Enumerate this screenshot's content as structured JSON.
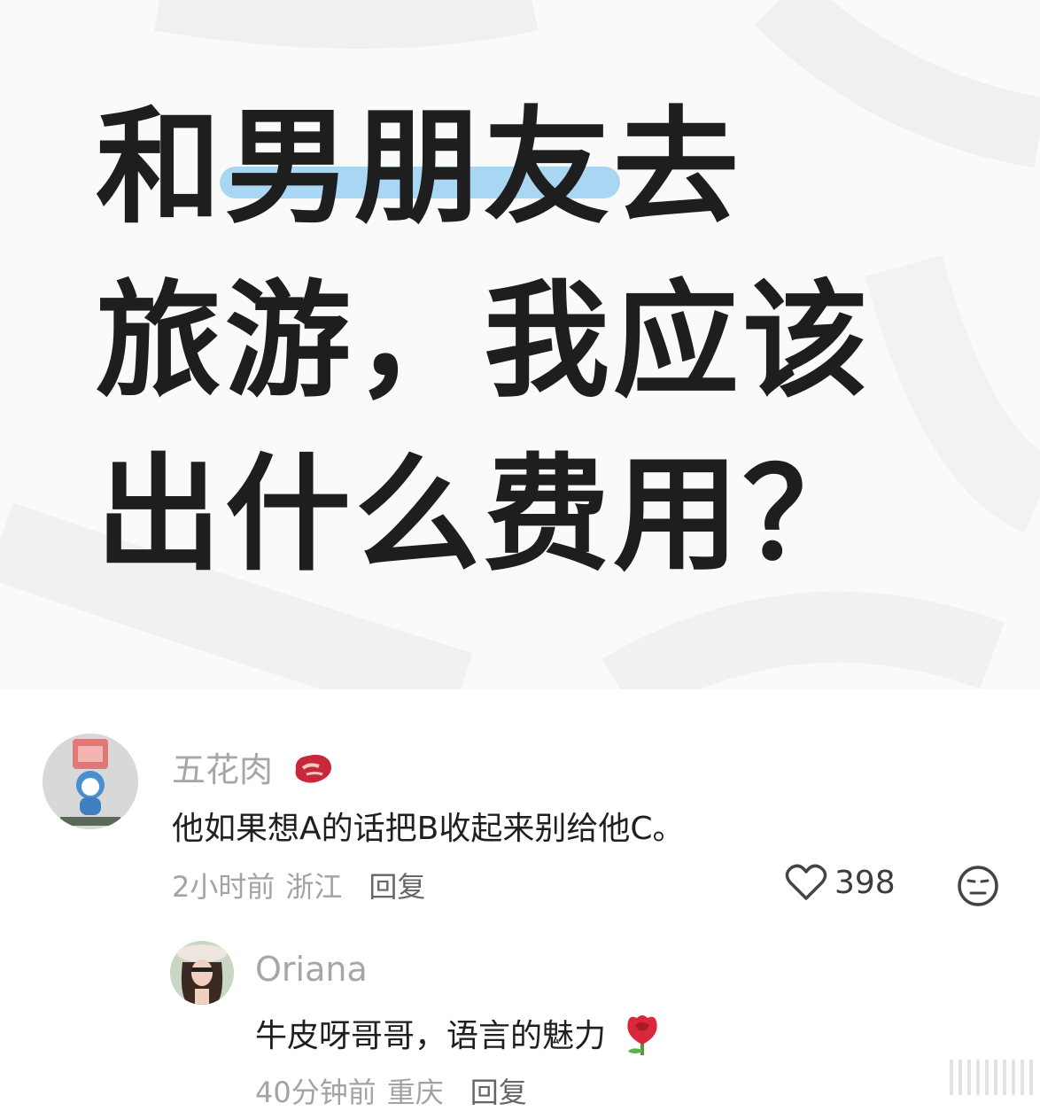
{
  "post": {
    "title_line1_pre": "和",
    "title_line1_highlight": "男朋友",
    "title_line1_post": "去",
    "title_line2": "旅游，我应该",
    "title_line3": "出什么费用？",
    "highlight_color": "#a9d7f3"
  },
  "comments": [
    {
      "name": "五花肉",
      "badge_icon": "steak-icon",
      "text": "他如果想A的话把B收起来别给他C。",
      "time": "2小时前",
      "location": "浙江",
      "reply_label": "回复",
      "likes": "398"
    }
  ],
  "replies": [
    {
      "name": "Oriana",
      "text": "牛皮呀哥哥，语言的魅力",
      "text_icon": "rose-icon",
      "time": "40分钟前",
      "location": "重庆",
      "reply_label": "回复"
    }
  ]
}
